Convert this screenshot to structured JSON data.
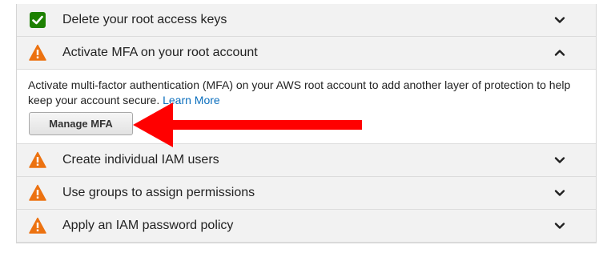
{
  "checklist": {
    "items": [
      {
        "label": "Delete your root access keys",
        "status": "complete",
        "status_icon": "green-check-icon",
        "expanded": false
      },
      {
        "label": "Activate MFA on your root account",
        "status": "warning",
        "status_icon": "warning-triangle-icon",
        "expanded": true
      },
      {
        "label": "Create individual IAM users",
        "status": "warning",
        "status_icon": "warning-triangle-icon",
        "expanded": false
      },
      {
        "label": "Use groups to assign permissions",
        "status": "warning",
        "status_icon": "warning-triangle-icon",
        "expanded": false
      },
      {
        "label": "Apply an IAM password policy",
        "status": "warning",
        "status_icon": "warning-triangle-icon",
        "expanded": false
      }
    ],
    "mfa_detail": {
      "description": "Activate multi-factor authentication (MFA) on your AWS root account to add another layer of protection to help keep your account secure.",
      "learn_more": "Learn More",
      "button_label": "Manage MFA"
    }
  },
  "colors": {
    "complete": "#1d8102",
    "warning": "#ec7211",
    "link": "#0a6ebd",
    "annotation_arrow": "#ff0000",
    "row_background": "#f2f2f2"
  }
}
